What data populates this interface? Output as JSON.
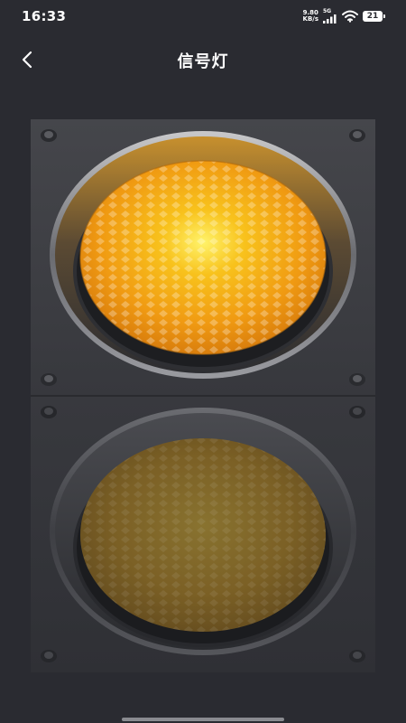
{
  "status_bar": {
    "time": "16:33",
    "net_speed_value": "9.80",
    "net_speed_unit": "KB/s",
    "network_type": "5G",
    "battery_level": "21"
  },
  "nav": {
    "title": "信号灯"
  },
  "traffic_light": {
    "upper_lamp_state": "on",
    "lower_lamp_state": "off",
    "lamp_color": "#f0a515",
    "housing_color": "#3e3f44"
  }
}
